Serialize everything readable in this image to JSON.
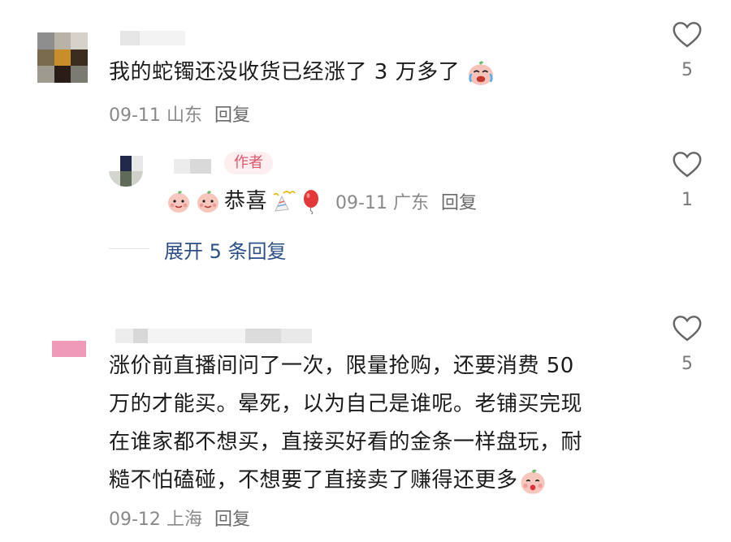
{
  "comments": [
    {
      "text": "我的蛇镯还没收货已经涨了 3 万多了",
      "date": "09-11",
      "location": "山东",
      "reply_label": "回复",
      "likes": "5",
      "trailing_emoji": "crying-laugh-emoji"
    },
    {
      "is_reply": true,
      "badge": "作者",
      "text": "恭喜",
      "date": "09-11",
      "location": "广东",
      "reply_label": "回复",
      "likes": "1",
      "emojis": [
        "peach-face-emoji",
        "peach-face-emoji",
        "party-popper-emoji",
        "balloon-emoji"
      ]
    },
    {
      "text_lines": [
        "涨价前直播间问了一次，限量抢购，还要消费 50",
        "万的才能买。晕死，以为自己是谁呢。老铺买完现",
        "在谁家都不想买，直接买好看的金条一样盘玩，耐",
        "糙不怕磕碰，不想要了直接卖了赚得还更多"
      ],
      "date": "09-12",
      "location": "上海",
      "reply_label": "回复",
      "likes": "5",
      "trailing_emoji": "blush-peach-emoji"
    }
  ],
  "expand_replies": "展开 5 条回复",
  "colors": {
    "author_badge_bg": "#fdeef0",
    "author_badge_text": "#e0566b",
    "expand_link": "#2b4f86",
    "meta_gray": "#8a8a8a"
  },
  "icons": [
    "heart-outline-icon",
    "heart-outline-icon",
    "heart-outline-icon"
  ]
}
